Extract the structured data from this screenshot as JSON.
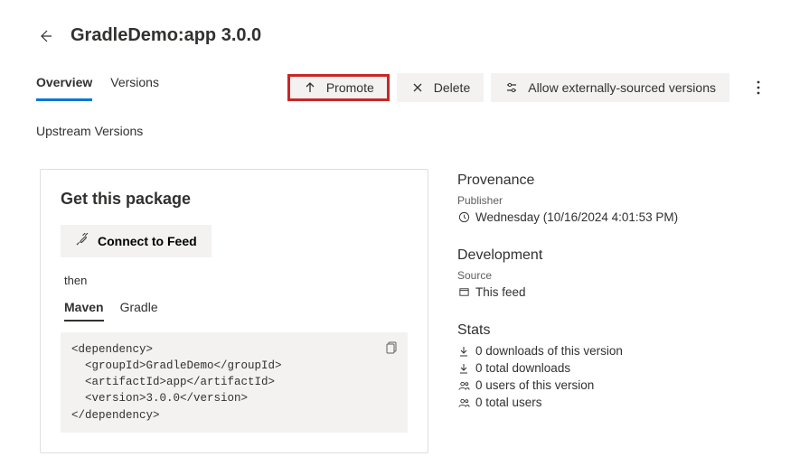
{
  "header": {
    "title": "GradleDemo:app 3.0.0"
  },
  "tabs": [
    {
      "label": "Overview",
      "active": true
    },
    {
      "label": "Versions",
      "active": false
    }
  ],
  "actions": {
    "promote": "Promote",
    "delete": "Delete",
    "allow_external": "Allow externally-sourced versions"
  },
  "sub_section": "Upstream Versions",
  "package_panel": {
    "title": "Get this package",
    "connect_label": "Connect to Feed",
    "then": "then",
    "tabs": [
      {
        "label": "Maven",
        "active": true
      },
      {
        "label": "Gradle",
        "active": false
      }
    ],
    "code": "<dependency>\n  <groupId>GradleDemo</groupId>\n  <artifactId>app</artifactId>\n  <version>3.0.0</version>\n</dependency>"
  },
  "provenance": {
    "title": "Provenance",
    "publisher_label": "Publisher",
    "published_at": "Wednesday (10/16/2024 4:01:53 PM)"
  },
  "development": {
    "title": "Development",
    "source_label": "Source",
    "source_value": "This feed"
  },
  "stats": {
    "title": "Stats",
    "rows": [
      "0 downloads of this version",
      "0 total downloads",
      "0 users of this version",
      "0 total users"
    ]
  }
}
